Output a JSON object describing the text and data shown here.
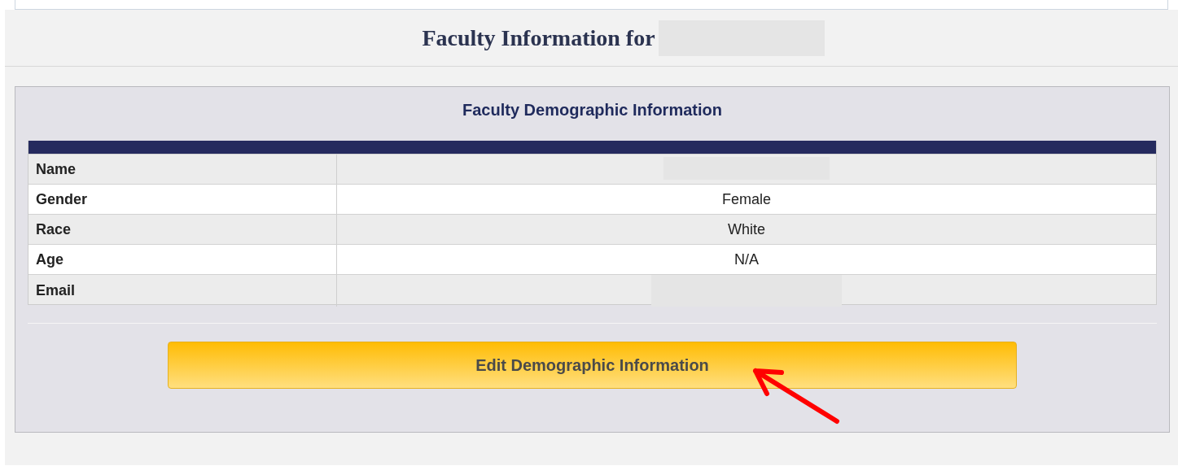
{
  "page": {
    "title": "Faculty Information for",
    "title_redacted": true
  },
  "panel": {
    "heading": "Faculty Demographic Information",
    "rows": [
      {
        "label": "Name",
        "value_redacted": true
      },
      {
        "label": "Gender",
        "value": "Female"
      },
      {
        "label": "Race",
        "value": "White"
      },
      {
        "label": "Age",
        "value": "N/A"
      },
      {
        "label": "Email",
        "value_redacted": true
      }
    ],
    "button": "Edit Demographic Information",
    "callout": {
      "kind": "arrow"
    }
  }
}
